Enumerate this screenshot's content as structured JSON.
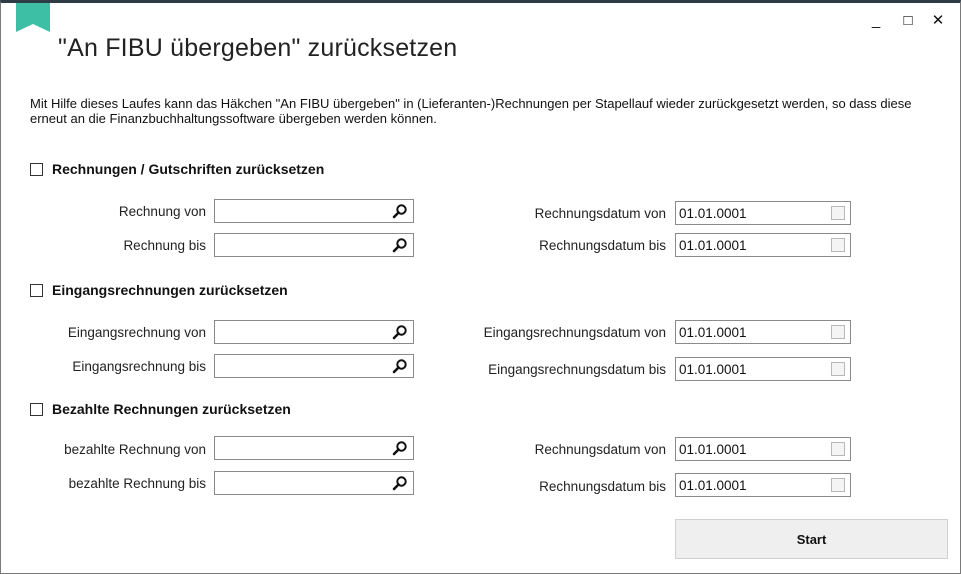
{
  "window": {
    "title": "\"An FIBU übergeben\" zurücksetzen",
    "minimize_glyph": "_",
    "maximize_glyph": "□",
    "close_glyph": "✕",
    "header_color": "#2f3b45",
    "accent_color": "#3dbfa6"
  },
  "description": "Mit Hilfe dieses Laufes kann das Häkchen \"An FIBU übergeben\" in (Lieferanten-)Rechnungen per Stapellauf wieder zurückgesetzt werden, so dass diese erneut an die Finanzbuchhaltungssoftware übergeben werden können.",
  "sections": [
    {
      "label": "Rechnungen / Gutschriften zurücksetzen",
      "checked": false,
      "from_label": "Rechnung von",
      "to_label": "Rechnung bis",
      "date_from_label": "Rechnungsdatum von",
      "date_to_label": "Rechnungsdatum bis",
      "date_from": "01.01.0001",
      "date_to": "01.01.0001"
    },
    {
      "label": "Eingangsrechnungen zurücksetzen",
      "checked": false,
      "from_label": "Eingangsrechnung von",
      "to_label": "Eingangsrechnung bis",
      "date_from_label": "Eingangsrechnungsdatum von",
      "date_to_label": "Eingangsrechnungsdatum bis",
      "date_from": "01.01.0001",
      "date_to": "01.01.0001"
    },
    {
      "label": "Bezahlte Rechnungen zurücksetzen",
      "checked": false,
      "from_label": "bezahlte Rechnung von",
      "to_label": "bezahlte Rechnung bis",
      "date_from_label": "Rechnungsdatum von",
      "date_to_label": "Rechnungsdatum bis",
      "date_from": "01.01.0001",
      "date_to": "01.01.0001"
    }
  ],
  "start_label": "Start"
}
